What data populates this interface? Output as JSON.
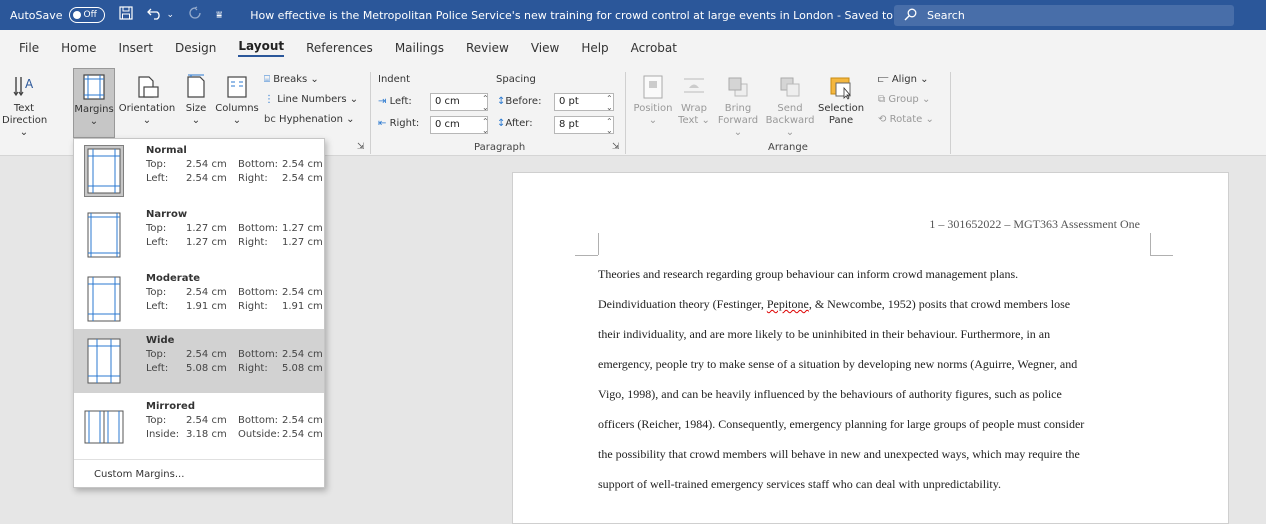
{
  "titlebar": {
    "autosave_label": "AutoSave",
    "autosave_state": "Off",
    "doc_title": "How effective is the Metropolitan Police Service's new training for crowd control at large events in London  -  Saved to this PC  ⌄",
    "search_placeholder": "Search"
  },
  "menu": {
    "tabs": [
      "File",
      "Home",
      "Insert",
      "Design",
      "Layout",
      "References",
      "Mailings",
      "Review",
      "View",
      "Help",
      "Acrobat"
    ],
    "active": "Layout"
  },
  "ribbon": {
    "text_direction": "Text Direction ⌄",
    "text_direction_l1": "Text",
    "text_direction_l2": "Direction ⌄",
    "margins": "Margins",
    "orientation": "Orientation",
    "size": "Size",
    "columns": "Columns",
    "breaks": "Breaks ⌄",
    "line_numbers": "Line Numbers ⌄",
    "hyphenation": "Hyphenation ⌄",
    "indent_label": "Indent",
    "spacing_label": "Spacing",
    "left_label": "Left:",
    "left_value": "0 cm",
    "right_label": "Right:",
    "right_value": "0 cm",
    "before_label": "Before:",
    "before_value": "0 pt",
    "after_label": "After:",
    "after_value": "8 pt",
    "paragraph_group": "Paragraph",
    "position": "Position",
    "wrap_text_l1": "Wrap",
    "wrap_text_l2": "Text ⌄",
    "bring_forward_l1": "Bring",
    "bring_forward_l2": "Forward ⌄",
    "send_backward_l1": "Send",
    "send_backward_l2": "Backward ⌄",
    "selection_pane_l1": "Selection",
    "selection_pane_l2": "Pane",
    "align": "Align ⌄",
    "group": "Group ⌄",
    "rotate": "Rotate ⌄",
    "arrange_group": "Arrange"
  },
  "margins_menu": {
    "options": [
      {
        "name": "Normal",
        "k1": "Top:",
        "v1": "2.54 cm",
        "k2": "Bottom:",
        "v2": "2.54 cm",
        "k3": "Left:",
        "v3": "2.54 cm",
        "k4": "Right:",
        "v4": "2.54 cm"
      },
      {
        "name": "Narrow",
        "k1": "Top:",
        "v1": "1.27 cm",
        "k2": "Bottom:",
        "v2": "1.27 cm",
        "k3": "Left:",
        "v3": "1.27 cm",
        "k4": "Right:",
        "v4": "1.27 cm"
      },
      {
        "name": "Moderate",
        "k1": "Top:",
        "v1": "2.54 cm",
        "k2": "Bottom:",
        "v2": "2.54 cm",
        "k3": "Left:",
        "v3": "1.91 cm",
        "k4": "Right:",
        "v4": "1.91 cm"
      },
      {
        "name": "Wide",
        "k1": "Top:",
        "v1": "2.54 cm",
        "k2": "Bottom:",
        "v2": "2.54 cm",
        "k3": "Left:",
        "v3": "5.08 cm",
        "k4": "Right:",
        "v4": "5.08 cm"
      },
      {
        "name": "Mirrored",
        "k1": "Top:",
        "v1": "2.54 cm",
        "k2": "Bottom:",
        "v2": "2.54 cm",
        "k3": "Inside:",
        "v3": "3.18 cm",
        "k4": "Outside:",
        "v4": "2.54 cm"
      }
    ],
    "custom": "Custom Margins..."
  },
  "document": {
    "header": "1 – 301652022 – MGT363 Assessment One",
    "lines": [
      "Theories and research regarding group behaviour can inform crowd management plans.",
      "Deindividuation theory (Festinger, Pepitone, & Newcombe, 1952) posits that crowd members lose",
      "their individuality, and are more likely to be uninhibited in their behaviour.  Furthermore, in an",
      "emergency, people try to make sense of a situation by developing new norms (Aguirre, Wegner, and",
      "Vigo, 1998), and can be heavily influenced by the behaviours of authority figures, such as police",
      "officers (Reicher, 1984).  Consequently, emergency planning for large groups of people must consider",
      "the possibility that crowd members will behave in new and unexpected ways, which may require the",
      "support of well-trained emergency services staff who can deal with unpredictability."
    ]
  },
  "colors": {
    "titlebar": "#2b579a",
    "ribbon": "#f3f3f3"
  }
}
